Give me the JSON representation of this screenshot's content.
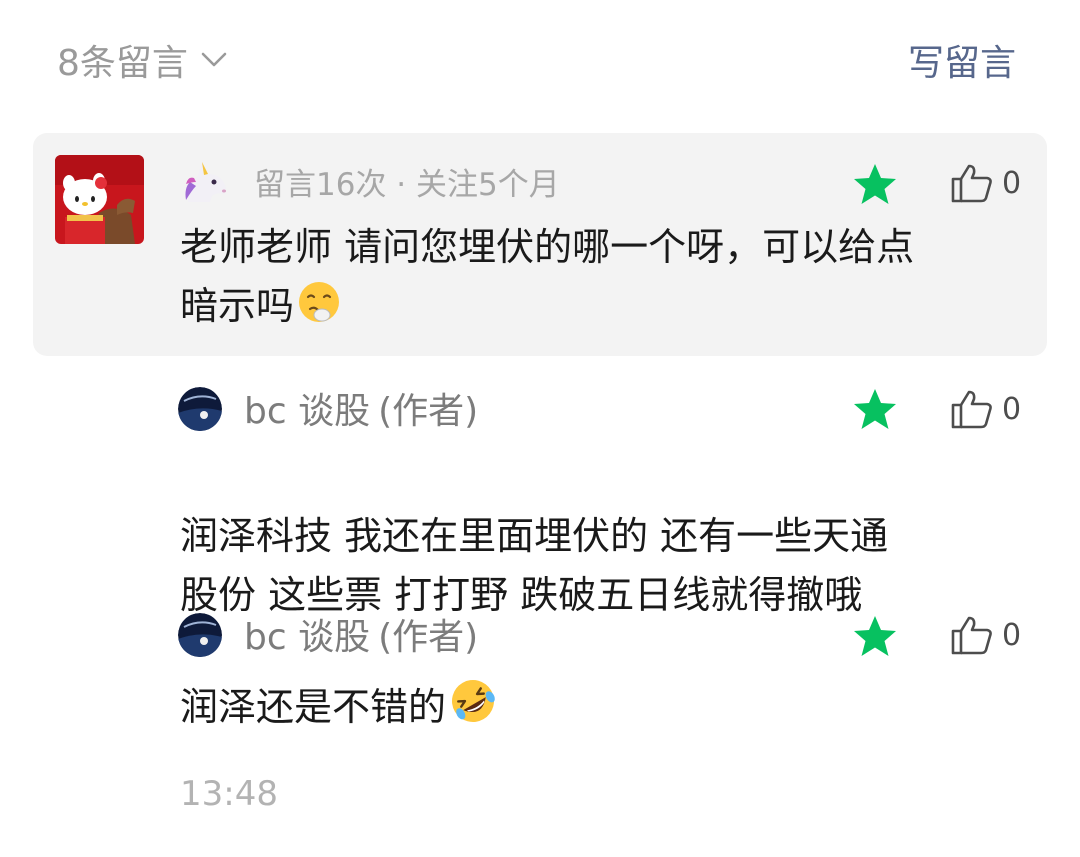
{
  "header": {
    "count_label": "8条留言",
    "write_label": "写留言"
  },
  "comment": {
    "avatar_icon": "hello-kitty-avatar",
    "badge_icon": "unicorn-emoji",
    "meta": "留言16次 · 关注5个月",
    "likes": "0",
    "text": "老师老师 请问您埋伏的哪一个呀，可以给点\n暗示吗",
    "emoji": "worried-face-emoji"
  },
  "replies": [
    {
      "author": "bc 谈股",
      "author_tag": "(作者)",
      "likes": "0",
      "text": "润泽科技 我还在里面埋伏的 还有一些天通\n股份 这些票 打打野  跌破五日线就得撤哦"
    },
    {
      "author": "bc 谈股",
      "author_tag": "(作者)",
      "likes": "0",
      "text": "润泽还是不错的",
      "emoji": "rofl-emoji"
    }
  ],
  "footer": {
    "time": "13:48"
  },
  "colors": {
    "star_green": "#07c160",
    "link_blue": "#57678c",
    "card_bg": "#f3f3f3"
  }
}
